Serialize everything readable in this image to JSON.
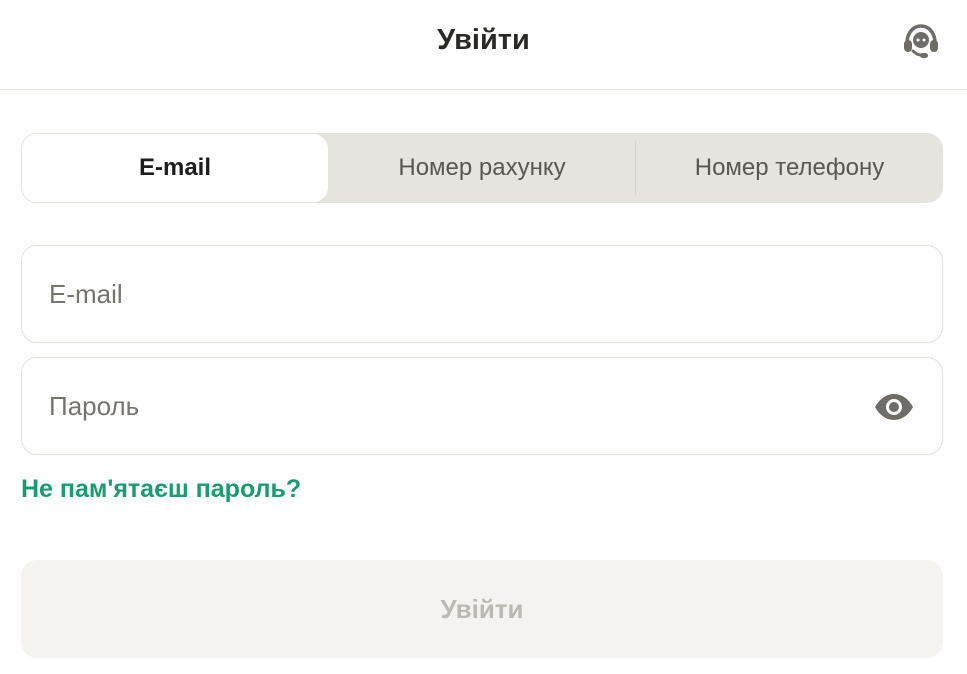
{
  "header": {
    "title": "Увійти",
    "support_icon": "headset-icon"
  },
  "tabs": [
    {
      "label": "E-mail",
      "active": true
    },
    {
      "label": "Номер рахунку",
      "active": false
    },
    {
      "label": "Номер телефону",
      "active": false
    }
  ],
  "form": {
    "email": {
      "placeholder": "E-mail",
      "value": ""
    },
    "password": {
      "placeholder": "Пароль",
      "value": "",
      "toggle_icon": "eye-icon"
    },
    "forgot_label": "Не пам'ятаєш пароль?",
    "submit_label": "Увійти"
  },
  "colors": {
    "accent": "#1a9d6d",
    "tabs_bg": "#e6e4df",
    "submit_bg": "#f5f3f0",
    "submit_text": "#bdb8b1"
  }
}
